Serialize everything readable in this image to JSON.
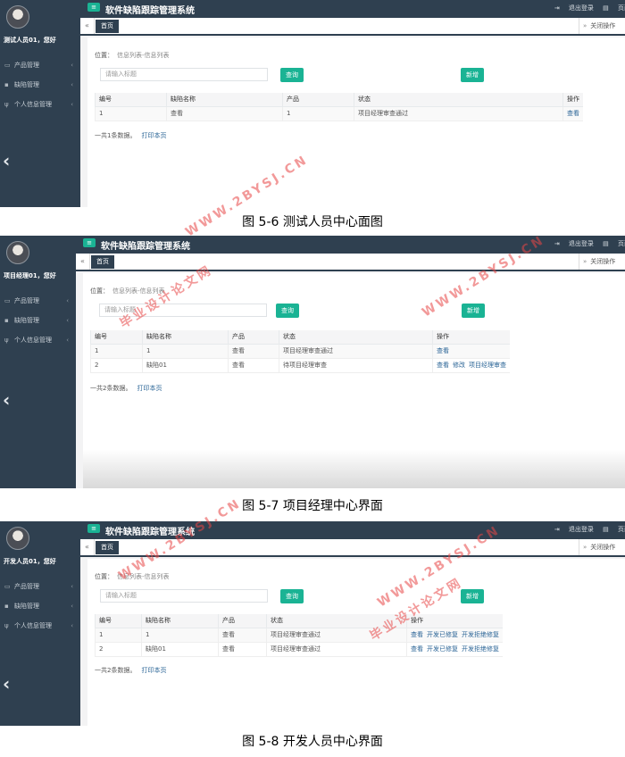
{
  "app": {
    "title": "软件缺陷跟踪管理系统"
  },
  "topbar": {
    "logout": "退出登录",
    "page_tab": "页面"
  },
  "tabs": {
    "home": "首页",
    "close_ops": "关闭操作"
  },
  "menu": {
    "product": "产品管理",
    "defect": "缺陷管理",
    "personal": "个人信息管理"
  },
  "common": {
    "location": "位置：",
    "location_value": "信息列表-信息列表",
    "search_placeholder": "请输入标题",
    "query_button": "查询",
    "add_button": "新增",
    "print": "打印本页",
    "view": "查看",
    "modify": "修改"
  },
  "columns": [
    "编号",
    "缺陷名称",
    "产品",
    "状态",
    "操作"
  ],
  "screens": [
    {
      "greeting": "测试人员01，您好",
      "rows": [
        {
          "id": "1",
          "name": "查看",
          "product": "1",
          "status": "项目经理审查通过",
          "actions": [
            "查看"
          ]
        }
      ],
      "summary": "一共1条数据。",
      "caption": "图 5-6 测试人员中心面图"
    },
    {
      "greeting": "项目经理01，您好",
      "rows": [
        {
          "id": "1",
          "name": "1",
          "product": "查看",
          "status": "项目经理审查通过",
          "actions": [
            "查看"
          ]
        },
        {
          "id": "2",
          "name": "缺陷01",
          "product": "查看",
          "status": "待项目经理审查",
          "actions": [
            "查看",
            "修改",
            "项目经理审查"
          ]
        }
      ],
      "summary": "一共2条数据。",
      "caption": "图 5-7 项目经理中心界面"
    },
    {
      "greeting": "开发人员01，您好",
      "rows": [
        {
          "id": "1",
          "name": "1",
          "product": "查看",
          "status": "项目经理审查通过",
          "actions": [
            "查看",
            "开发已修复",
            "开发拒绝修复"
          ]
        },
        {
          "id": "2",
          "name": "缺陷01",
          "product": "查看",
          "status": "项目经理审查通过",
          "actions": [
            "查看",
            "开发已修复",
            "开发拒绝修复"
          ]
        }
      ],
      "summary": "一共2条数据。",
      "caption": "图 5-8 开发人员中心界面"
    }
  ],
  "watermarks": [
    "WWW.2BYSJ.CN",
    "毕业设计论文网"
  ],
  "colors": {
    "sidebar": "#2f4050",
    "accent": "#1ab394",
    "status_red": "#c0392b",
    "link": "#2a6496"
  }
}
